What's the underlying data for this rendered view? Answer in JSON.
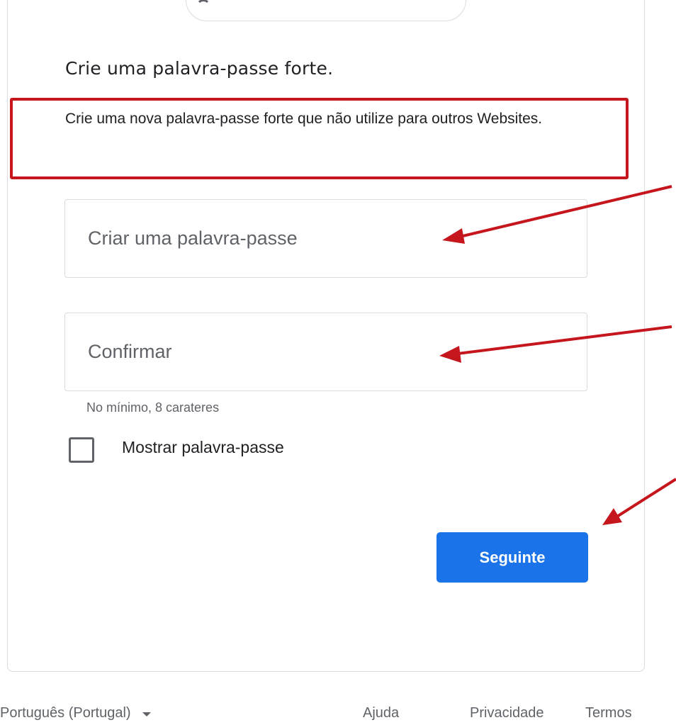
{
  "form": {
    "heading": "Crie uma palavra-passe forte.",
    "description": "Crie uma nova palavra-passe forte que não utilize para outros Websites.",
    "password_placeholder": "Criar uma palavra-passe",
    "password_value": "",
    "confirm_placeholder": "Confirmar",
    "confirm_value": "",
    "hint": "No mínimo, 8 carateres",
    "show_password_label": "Mostrar palavra-passe",
    "show_password_checked": false,
    "next_button": "Seguinte"
  },
  "footer": {
    "language": "Português (Portugal)",
    "help": "Ajuda",
    "privacy": "Privacidade",
    "terms": "Termos"
  },
  "annotations": {
    "highlight_color": "#c4161c",
    "arrow_color": "#c4161c"
  },
  "colors": {
    "primary": "#1a73e8",
    "text": "#202124",
    "secondary_text": "#5f6368",
    "border": "#dadce0"
  }
}
